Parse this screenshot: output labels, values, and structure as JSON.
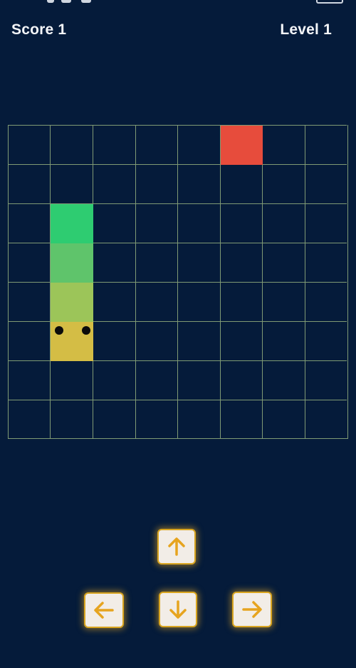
{
  "hud": {
    "score_text": "Score 1",
    "level_text": "Level 1",
    "score": 1,
    "level": 1
  },
  "board": {
    "columns": 8,
    "rows": 8,
    "grid_line_color": "#7f9a74",
    "background_color": "#051b3a"
  },
  "food": {
    "column": 5,
    "row": 0,
    "color": "#e74c3c"
  },
  "snake": {
    "direction": "down",
    "head": {
      "column": 1,
      "row": 5,
      "color": "#d4bd45"
    },
    "body": [
      {
        "column": 1,
        "row": 4,
        "color": "#9cc559"
      },
      {
        "column": 1,
        "row": 3,
        "color": "#5fc46b"
      },
      {
        "column": 1,
        "row": 2,
        "color": "#2ecc71"
      }
    ]
  },
  "controls": {
    "up": {
      "icon": "arrow-up-icon"
    },
    "left": {
      "icon": "arrow-left-icon"
    },
    "down": {
      "icon": "arrow-down-icon"
    },
    "right": {
      "icon": "arrow-right-icon"
    },
    "border_color": "#d9a520",
    "arrow_color": "#e6a41f"
  }
}
